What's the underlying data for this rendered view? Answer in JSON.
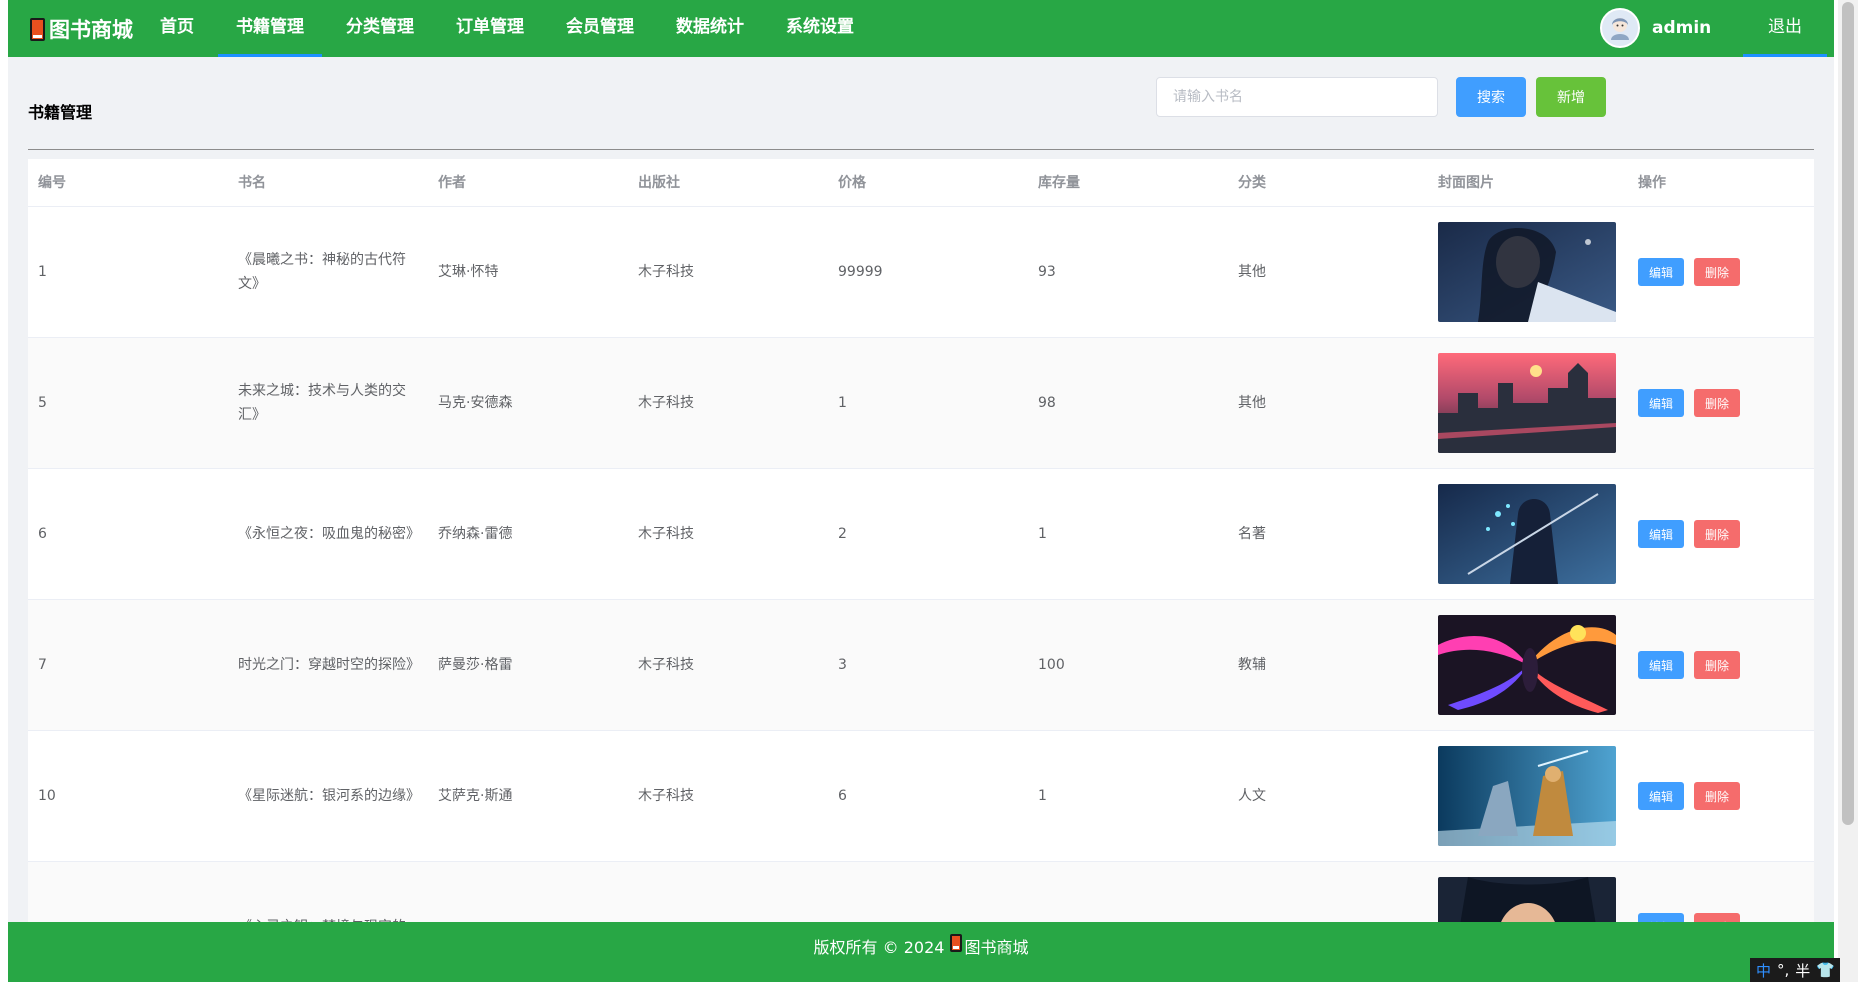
{
  "app": {
    "logo_text": "图书商城",
    "nav": [
      {
        "label": "首页"
      },
      {
        "label": "书籍管理"
      },
      {
        "label": "分类管理"
      },
      {
        "label": "订单管理"
      },
      {
        "label": "会员管理"
      },
      {
        "label": "数据统计"
      },
      {
        "label": "系统设置"
      }
    ],
    "active_nav": "书籍管理",
    "username": "admin",
    "logout_label": "退出",
    "colors": {
      "header": "#28a745",
      "primary": "#409eff",
      "success": "#67c23a",
      "danger": "#f56c6c"
    }
  },
  "main": {
    "page_title": "书籍管理",
    "search_placeholder": "请输入书名",
    "search_label": "搜索",
    "add_label": "新增",
    "table": {
      "columns": [
        "编号",
        "书名",
        "作者",
        "出版社",
        "价格",
        "库存量",
        "分类",
        "封面图片",
        "操作"
      ],
      "edit_label": "编辑",
      "delete_label": "删除",
      "rows": [
        {
          "id": "1",
          "title": "《晨曦之书：神秘的古代符文》",
          "author": "艾琳·怀特",
          "publisher": "木子科技",
          "price": "99999",
          "stock": "93",
          "category": "其他"
        },
        {
          "id": "5",
          "title": "未来之城：技术与人类的交汇》",
          "author": "马克·安德森",
          "publisher": "木子科技",
          "price": "1",
          "stock": "98",
          "category": "其他"
        },
        {
          "id": "6",
          "title": "《永恒之夜：吸血鬼的秘密》",
          "author": "乔纳森·雷德",
          "publisher": "木子科技",
          "price": "2",
          "stock": "1",
          "category": "名著"
        },
        {
          "id": "7",
          "title": "时光之门：穿越时空的探险》",
          "author": "萨曼莎·格雷",
          "publisher": "木子科技",
          "price": "3",
          "stock": "100",
          "category": "教辅"
        },
        {
          "id": "10",
          "title": "《星际迷航：银河系的边缘》",
          "author": "艾萨克·斯通",
          "publisher": "木子科技",
          "price": "6",
          "stock": "1",
          "category": "人文"
        },
        {
          "id": "",
          "title": "《心灵之钥：梦境与现实的",
          "author": "",
          "publisher": "",
          "price": "",
          "stock": "",
          "category": ""
        }
      ]
    }
  },
  "footer": {
    "copyright": "版权所有 © 2024",
    "brand": "图书商城"
  },
  "ime": {
    "mode": "中",
    "punct": "°,",
    "width": "半"
  }
}
